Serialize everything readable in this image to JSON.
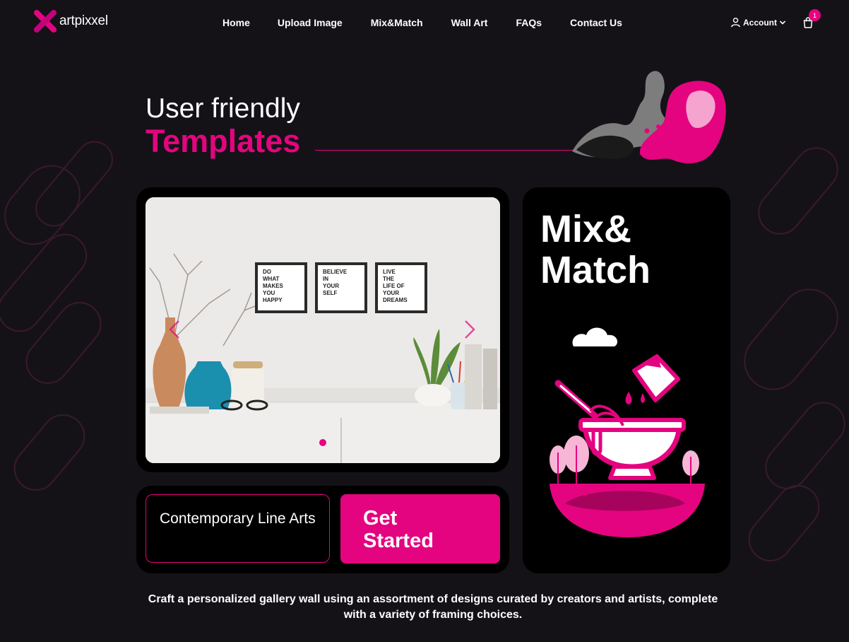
{
  "brand": {
    "name": "artpixxel",
    "accent": "#e4047f",
    "background": "#141217"
  },
  "nav": {
    "items": [
      {
        "label": "Home",
        "active": true
      },
      {
        "label": "Upload Image"
      },
      {
        "label": "Mix&Match"
      },
      {
        "label": "Wall Art"
      },
      {
        "label": "FAQs"
      },
      {
        "label": "Contact Us"
      }
    ]
  },
  "account": {
    "label": "Account",
    "icon": "user-icon",
    "caret": "chevron-down-icon"
  },
  "cart": {
    "icon": "shopping-bag-icon",
    "count": "1"
  },
  "hero": {
    "line1": "User friendly",
    "line2": "Templates"
  },
  "slider": {
    "prev_icon": "chevron-left-icon",
    "next_icon": "chevron-right-icon",
    "frames": [
      [
        "DO",
        "WHAT",
        "MAKES",
        "YOU",
        "HAPPY"
      ],
      [
        "BELIEVE",
        "IN",
        "YOUR",
        "SELF"
      ],
      [
        "LIVE",
        "THE",
        "LIFE OF",
        "YOUR",
        "DREAMS"
      ]
    ],
    "active_dot": 1,
    "dot_count": 1
  },
  "category": {
    "label": "Contemporary Line Arts"
  },
  "cta": {
    "label": "Get Started"
  },
  "mix": {
    "title": "Mix& Match"
  },
  "tagline": "Craft a personalized gallery wall using an assortment of designs curated by creators and artists, complete with a variety of framing choices."
}
